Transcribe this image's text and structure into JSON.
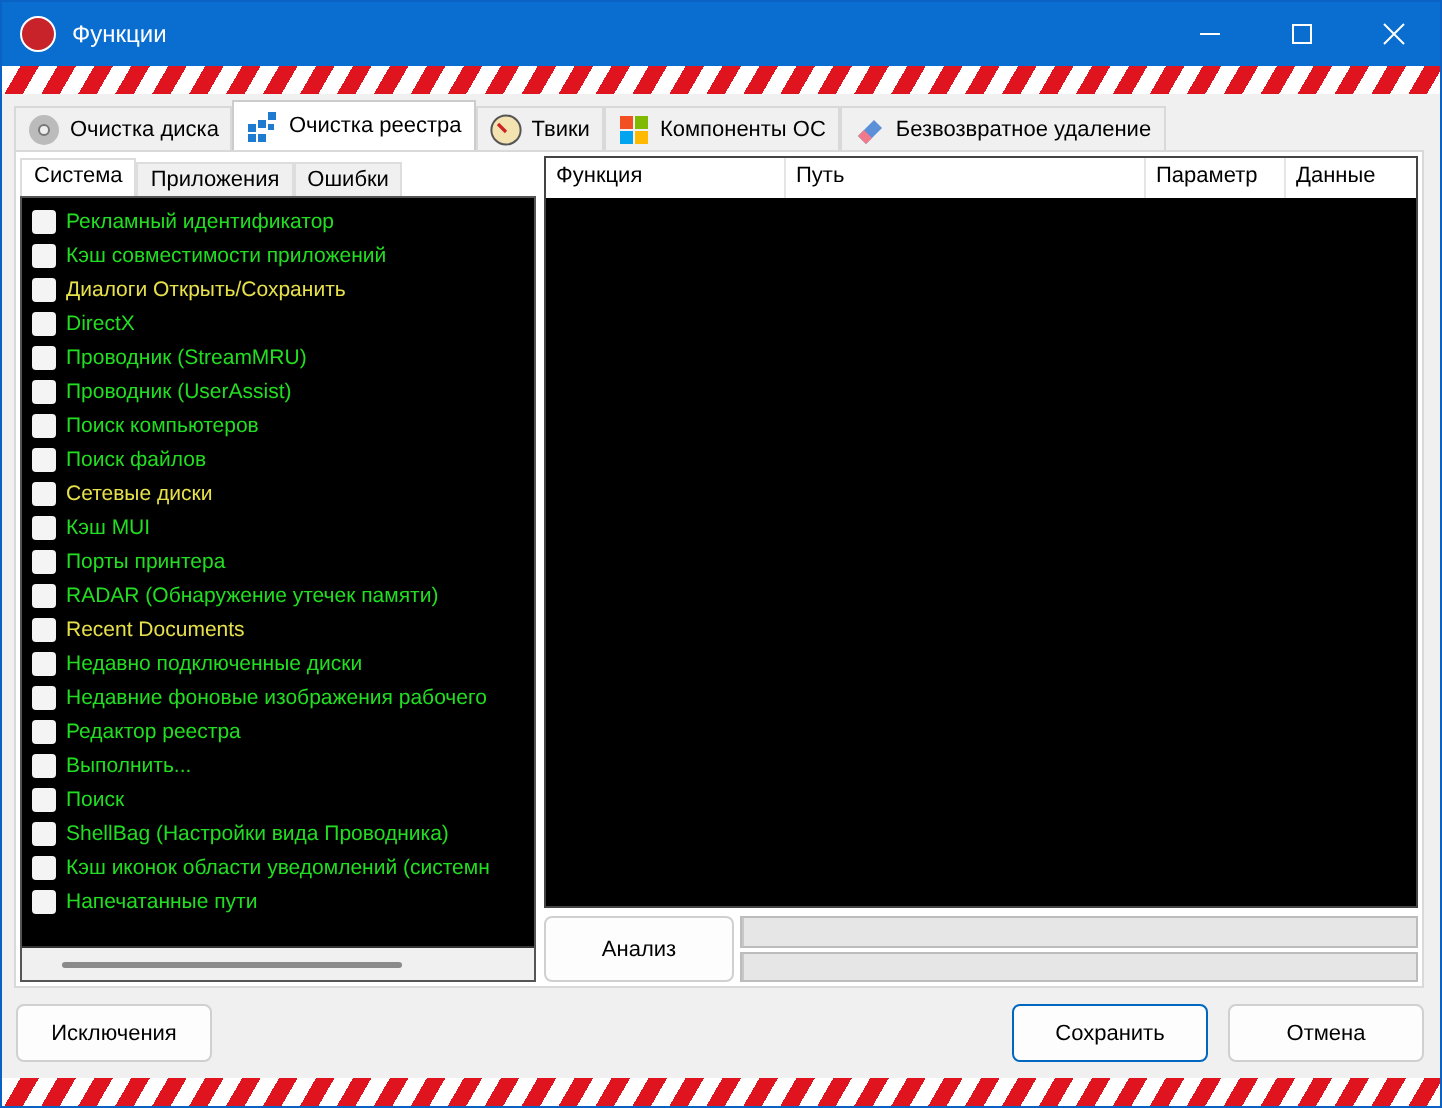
{
  "window": {
    "title": "Функции"
  },
  "tabs": [
    {
      "label": "Очистка диска",
      "selected": false
    },
    {
      "label": "Очистка реестра",
      "selected": true
    },
    {
      "label": "Твики",
      "selected": false
    },
    {
      "label": "Компоненты ОС",
      "selected": false
    },
    {
      "label": "Безвозвратное удаление",
      "selected": false
    }
  ],
  "subtabs": [
    {
      "label": "Система",
      "selected": true
    },
    {
      "label": "Приложения",
      "selected": false
    },
    {
      "label": "Ошибки",
      "selected": false
    }
  ],
  "items": [
    {
      "label": "Рекламный идентификатор",
      "checked": false,
      "color": "#22dd22"
    },
    {
      "label": "Кэш совместимости приложений",
      "checked": false,
      "color": "#22dd22"
    },
    {
      "label": "Диалоги Открыть/Сохранить",
      "checked": false,
      "color": "#e6e04a"
    },
    {
      "label": "DirectX",
      "checked": false,
      "color": "#22dd22"
    },
    {
      "label": "Проводник (StreamMRU)",
      "checked": false,
      "color": "#22dd22"
    },
    {
      "label": "Проводник (UserAssist)",
      "checked": false,
      "color": "#22dd22"
    },
    {
      "label": "Поиск компьютеров",
      "checked": false,
      "color": "#22dd22"
    },
    {
      "label": "Поиск файлов",
      "checked": false,
      "color": "#22dd22"
    },
    {
      "label": "Сетевые диски",
      "checked": false,
      "color": "#e6e04a"
    },
    {
      "label": "Кэш MUI",
      "checked": false,
      "color": "#22dd22"
    },
    {
      "label": "Порты принтера",
      "checked": false,
      "color": "#22dd22"
    },
    {
      "label": "RADAR (Обнаружение утечек памяти)",
      "checked": false,
      "color": "#22dd22"
    },
    {
      "label": "Recent Documents",
      "checked": false,
      "color": "#e6e04a"
    },
    {
      "label": "Недавно подключенные диски",
      "checked": false,
      "color": "#22dd22"
    },
    {
      "label": "Недавние фоновые изображения рабочего",
      "checked": false,
      "color": "#22dd22"
    },
    {
      "label": "Редактор реестра",
      "checked": false,
      "color": "#22dd22"
    },
    {
      "label": "Выполнить...",
      "checked": false,
      "color": "#22dd22"
    },
    {
      "label": "Поиск",
      "checked": false,
      "color": "#22dd22"
    },
    {
      "label": "ShellBag (Настройки вида Проводника)",
      "checked": false,
      "color": "#22dd22"
    },
    {
      "label": "Кэш иконок области уведомлений (системн",
      "checked": false,
      "color": "#22dd22"
    },
    {
      "label": "Напечатанные пути",
      "checked": false,
      "color": "#22dd22"
    }
  ],
  "table": {
    "columns": [
      "Функция",
      "Путь",
      "Параметр",
      "Данные"
    ]
  },
  "analyze_button": "Анализ",
  "progress": [
    {
      "level": 0
    },
    {
      "level": 0
    }
  ],
  "buttons": [
    {
      "label": "Исключения",
      "kind": "plain"
    },
    {
      "label": "Сохранить",
      "kind": "default"
    },
    {
      "label": "Отмена",
      "kind": "plain"
    }
  ]
}
